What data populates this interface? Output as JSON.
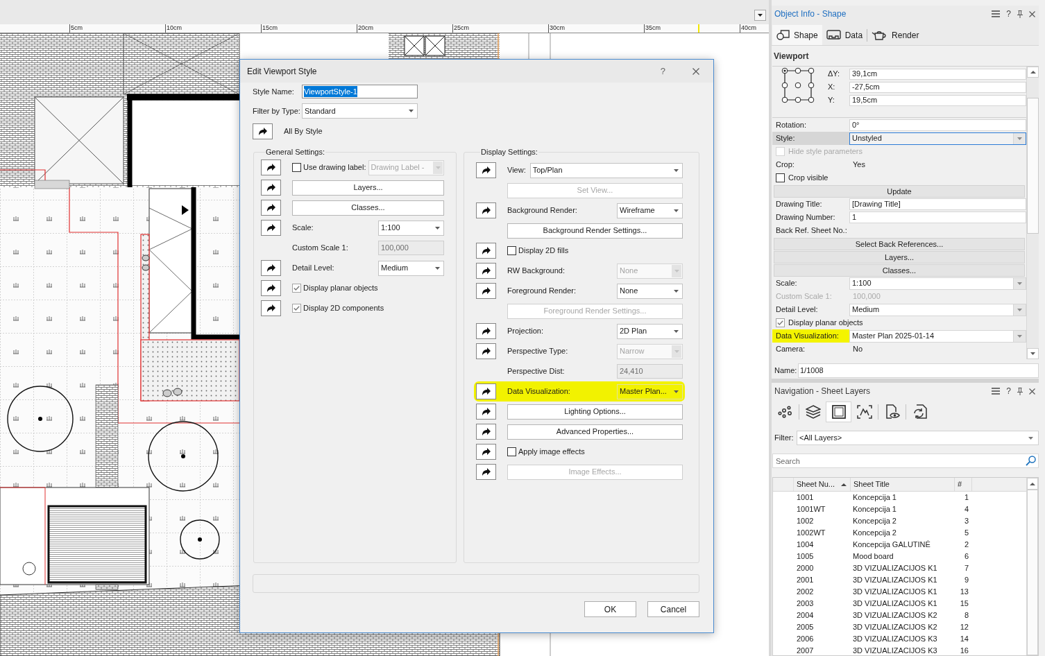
{
  "canvas": {
    "ruler": {
      "labels": [
        "5cm",
        "10cm",
        "15cm",
        "20cm",
        "25cm",
        "30cm",
        "35cm",
        "40cm"
      ]
    }
  },
  "dialog": {
    "title": "Edit Viewport Style",
    "help": "?",
    "style_name": {
      "label": "Style Name:",
      "value": "ViewportStyle-1",
      "text_selected": true
    },
    "filter_by_type": {
      "label": "Filter by Type:",
      "value": "Standard"
    },
    "all_by_style": {
      "label": "All By Style"
    },
    "general_settings": {
      "title": "General Settings:",
      "rows": [
        {
          "kind": "checkbox_dropdown",
          "style_toggle": true,
          "label": "Use drawing label:",
          "checked": false,
          "value": "Drawing Label -",
          "disabled": true,
          "highlighted": false
        },
        {
          "kind": "button",
          "style_toggle": true,
          "label": "Layers...",
          "disabled": false,
          "highlighted": false
        },
        {
          "kind": "button",
          "style_toggle": true,
          "label": "Classes...",
          "disabled": false,
          "highlighted": false
        },
        {
          "kind": "dropdown",
          "style_toggle": true,
          "label": "Scale:",
          "value": "1:100",
          "disabled": false,
          "highlighted": false
        },
        {
          "kind": "field",
          "style_toggle": false,
          "label": "Custom Scale 1:",
          "value": "100,000",
          "disabled": true,
          "highlighted": false
        },
        {
          "kind": "dropdown",
          "style_toggle": true,
          "label": "Detail Level:",
          "value": "Medium",
          "disabled": false,
          "highlighted": false
        },
        {
          "kind": "checkbox",
          "style_toggle": true,
          "label": "Display planar objects",
          "checked": true,
          "disabled": false,
          "highlighted": false
        },
        {
          "kind": "checkbox",
          "style_toggle": true,
          "label": "Display 2D components",
          "checked": true,
          "disabled": false,
          "highlighted": false
        }
      ]
    },
    "display_settings": {
      "title": "Display Settings:",
      "rows": [
        {
          "kind": "wide_dropdown",
          "style_toggle": true,
          "label": "View:",
          "value": "Top/Plan",
          "disabled": false,
          "highlighted": false
        },
        {
          "kind": "button",
          "style_toggle": false,
          "label": "Set View...",
          "disabled": true,
          "highlighted": false
        },
        {
          "kind": "dropdown",
          "style_toggle": true,
          "label": "Background Render:",
          "value": "Wireframe",
          "disabled": false,
          "highlighted": false
        },
        {
          "kind": "button",
          "style_toggle": false,
          "label": "Background Render Settings...",
          "disabled": false,
          "highlighted": false
        },
        {
          "kind": "checkbox",
          "style_toggle": true,
          "label": "Display 2D fills",
          "checked": false,
          "disabled": false,
          "highlighted": false
        },
        {
          "kind": "dropdown",
          "style_toggle": true,
          "label": "RW Background:",
          "value": "None",
          "disabled": true,
          "highlighted": false
        },
        {
          "kind": "dropdown",
          "style_toggle": true,
          "label": "Foreground Render:",
          "value": "None",
          "disabled": false,
          "highlighted": false
        },
        {
          "kind": "button",
          "style_toggle": false,
          "label": "Foreground Render Settings...",
          "disabled": true,
          "highlighted": false
        },
        {
          "kind": "dropdown",
          "style_toggle": true,
          "label": "Projection:",
          "value": "2D Plan",
          "disabled": false,
          "highlighted": false
        },
        {
          "kind": "dropdown",
          "style_toggle": true,
          "label": "Perspective Type:",
          "value": "Narrow",
          "disabled": true,
          "highlighted": false
        },
        {
          "kind": "field",
          "style_toggle": false,
          "label": "Perspective Dist:",
          "value": "24,410",
          "disabled": true,
          "highlighted": false
        },
        {
          "kind": "dropdown",
          "style_toggle": true,
          "label": "Data Visualization:",
          "value": "Master Plan...",
          "disabled": false,
          "highlighted": true
        },
        {
          "kind": "button",
          "style_toggle": true,
          "label": "Lighting Options...",
          "disabled": false,
          "highlighted": false
        },
        {
          "kind": "button",
          "style_toggle": true,
          "label": "Advanced Properties...",
          "disabled": false,
          "highlighted": false
        },
        {
          "kind": "checkbox",
          "style_toggle": true,
          "label": "Apply image effects",
          "checked": false,
          "disabled": false,
          "highlighted": false
        },
        {
          "kind": "button",
          "style_toggle": true,
          "label": "Image Effects...",
          "disabled": true,
          "highlighted": false
        }
      ]
    },
    "buttons": [
      {
        "label": "OK"
      },
      {
        "label": "Cancel"
      }
    ]
  },
  "object_info": {
    "title": "Object Info - Shape",
    "active": true,
    "help": "?",
    "tabs": [
      {
        "kind": "shape",
        "label": "Shape",
        "selected": true
      },
      {
        "kind": "data",
        "label": "Data",
        "selected": false
      },
      {
        "kind": "render",
        "label": "Render",
        "selected": false
      }
    ],
    "section": "Viewport",
    "coordinates": [
      {
        "label": "ΔY:",
        "value": "39,1cm"
      },
      {
        "label": "X:",
        "value": "-27,5cm"
      },
      {
        "label": "Y:",
        "value": "19,5cm"
      }
    ],
    "properties": [
      {
        "kind": "field",
        "label": "Rotation:",
        "value": "0°",
        "disabled": false,
        "selected": false,
        "highlighted": false
      },
      {
        "kind": "dropdown",
        "label": "Style:",
        "value": "Unstyled",
        "disabled": false,
        "selected": true,
        "highlighted": false
      },
      {
        "kind": "checkbox",
        "label": "Hide style parameters",
        "checked": false,
        "disabled": true,
        "selected": false,
        "highlighted": false
      },
      {
        "kind": "text",
        "label": "Crop:",
        "value": "Yes",
        "disabled": false,
        "selected": false,
        "highlighted": false
      },
      {
        "kind": "checkbox",
        "label": "Crop visible",
        "checked": false,
        "disabled": false,
        "selected": false,
        "highlighted": false
      },
      {
        "kind": "button",
        "label": "Update",
        "disabled": false,
        "selected": false,
        "highlighted": false
      },
      {
        "kind": "field",
        "label": "Drawing Title:",
        "value": "[Drawing Title]",
        "disabled": false,
        "selected": false,
        "highlighted": false
      },
      {
        "kind": "field",
        "label": "Drawing Number:",
        "value": "1",
        "disabled": false,
        "selected": false,
        "highlighted": false
      },
      {
        "kind": "text",
        "label": "Back Ref. Sheet No.:",
        "disabled": false,
        "selected": false,
        "highlighted": false
      },
      {
        "kind": "button",
        "label": "Select Back References...",
        "disabled": false,
        "selected": false,
        "highlighted": false
      },
      {
        "kind": "button",
        "label": "Layers...",
        "disabled": false,
        "selected": false,
        "highlighted": false
      },
      {
        "kind": "button",
        "label": "Classes...",
        "disabled": false,
        "selected": false,
        "highlighted": false
      },
      {
        "kind": "dropdown",
        "label": "Scale:",
        "value": "1:100",
        "disabled": false,
        "selected": false,
        "highlighted": false
      },
      {
        "kind": "text",
        "label": "Custom Scale 1:",
        "value": "100,000",
        "disabled": true,
        "selected": false,
        "highlighted": false
      },
      {
        "kind": "dropdown",
        "label": "Detail Level:",
        "value": "Medium",
        "disabled": false,
        "selected": false,
        "highlighted": false
      },
      {
        "kind": "checkbox",
        "label": "Display planar objects",
        "checked": true,
        "disabled": false,
        "selected": false,
        "highlighted": false
      },
      {
        "kind": "dropdown",
        "label": "Data Visualization:",
        "value": "Master Plan 2025-01-14",
        "disabled": false,
        "selected": false,
        "highlighted": true
      },
      {
        "kind": "text",
        "label": "Camera:",
        "value": "No",
        "disabled": false,
        "selected": false,
        "highlighted": false
      }
    ],
    "name": {
      "label": "Name:",
      "value": "1/1008"
    }
  },
  "navigation": {
    "title": "Navigation - Sheet Layers",
    "active": false,
    "help": "?",
    "tools": [
      {
        "kind": "nodes",
        "selected": false
      },
      {
        "kind": "layers",
        "selected": false
      },
      {
        "kind": "frame",
        "selected": true
      },
      {
        "kind": "landscape",
        "selected": false
      },
      {
        "kind": "preview",
        "selected": false
      },
      {
        "kind": "publish",
        "selected": false
      }
    ],
    "filter": {
      "label": "Filter:",
      "value": "<All Layers>"
    },
    "search": {
      "placeholder": "Search"
    },
    "table": {
      "columns": [
        {
          "label": "Sheet Nu...",
          "sorted": true
        },
        {
          "label": "Sheet Title",
          "sorted": false
        },
        {
          "label": "#",
          "sorted": false
        }
      ],
      "rows": [
        {
          "sheet_number": "1001",
          "sheet_title": "Koncepcija 1",
          "number": "1"
        },
        {
          "sheet_number": "1001WT",
          "sheet_title": "Koncepcija 1",
          "number": "4"
        },
        {
          "sheet_number": "1002",
          "sheet_title": "Koncepcija 2",
          "number": "3"
        },
        {
          "sheet_number": "1002WT",
          "sheet_title": "Koncepcija 2",
          "number": "5"
        },
        {
          "sheet_number": "1004",
          "sheet_title": "Koncepcija GALUTINĖ",
          "number": "2"
        },
        {
          "sheet_number": "1005",
          "sheet_title": "Mood board",
          "number": "6"
        },
        {
          "sheet_number": "2000",
          "sheet_title": "3D VIZUALIZACIJOS K1",
          "number": "7"
        },
        {
          "sheet_number": "2001",
          "sheet_title": "3D VIZUALIZACIJOS K1",
          "number": "9"
        },
        {
          "sheet_number": "2002",
          "sheet_title": "3D VIZUALIZACIJOS K1",
          "number": "13"
        },
        {
          "sheet_number": "2003",
          "sheet_title": "3D VIZUALIZACIJOS K1",
          "number": "15"
        },
        {
          "sheet_number": "2004",
          "sheet_title": "3D VIZUALIZACIJOS K2",
          "number": "8"
        },
        {
          "sheet_number": "2005",
          "sheet_title": "3D VIZUALIZACIJOS K2",
          "number": "12"
        },
        {
          "sheet_number": "2006",
          "sheet_title": "3D VIZUALIZACIJOS K3",
          "number": "14"
        },
        {
          "sheet_number": "2007",
          "sheet_title": "3D VIZUALIZACIJOS K3",
          "number": "16"
        }
      ]
    }
  }
}
